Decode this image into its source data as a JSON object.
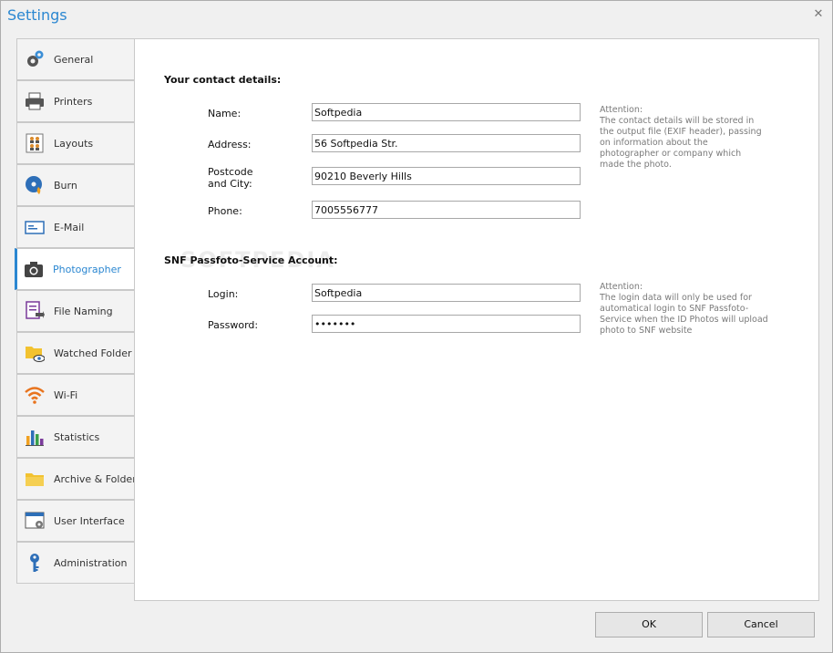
{
  "window": {
    "title": "Settings"
  },
  "icons": {
    "close": "close-icon"
  },
  "sidebar": {
    "active_color": "#2b87d1",
    "items": [
      {
        "label": "General",
        "icon": "gears-icon"
      },
      {
        "label": "Printers",
        "icon": "printer-icon"
      },
      {
        "label": "Layouts",
        "icon": "layouts-icon"
      },
      {
        "label": "Burn",
        "icon": "disc-burn-icon"
      },
      {
        "label": "E-Mail",
        "icon": "email-icon"
      },
      {
        "label": "Photographer",
        "icon": "camera-icon",
        "active": true
      },
      {
        "label": "File Naming",
        "icon": "file-naming-icon"
      },
      {
        "label": "Watched Folder",
        "icon": "watched-folder-icon"
      },
      {
        "label": "Wi-Fi",
        "icon": "wifi-icon"
      },
      {
        "label": "Statistics",
        "icon": "statistics-icon"
      },
      {
        "label": "Archive & Folders",
        "icon": "folder-icon"
      },
      {
        "label": "User Interface",
        "icon": "user-interface-icon"
      },
      {
        "label": "Administration",
        "icon": "key-icon"
      }
    ]
  },
  "contact": {
    "title": "Your contact details:",
    "name_label": "Name:",
    "name_value": "Softpedia",
    "address_label": "Address:",
    "address_value": "56 Softpedia Str.",
    "postcode_label_1": "Postcode",
    "postcode_label_2": "and City:",
    "postcode_value": "90210 Beverly Hills",
    "phone_label": "Phone:",
    "phone_value": "7005556777",
    "note_title": "Attention:",
    "note_text": "The contact details will be stored in the output file (EXIF header), passing on information about the photographer or company which made the photo."
  },
  "account": {
    "title": "SNF Passfoto-Service Account:",
    "login_label": "Login:",
    "login_value": "Softpedia",
    "password_label": "Password:",
    "password_value": "•••••••",
    "note_title": "Attention:",
    "note_text": "The login data will only be used for automatical login to SNF Passfoto-Service when the ID Photos will upload photo to SNF website"
  },
  "watermark": "SOFTPEDIA",
  "buttons": {
    "ok": "OK",
    "cancel": "Cancel"
  }
}
